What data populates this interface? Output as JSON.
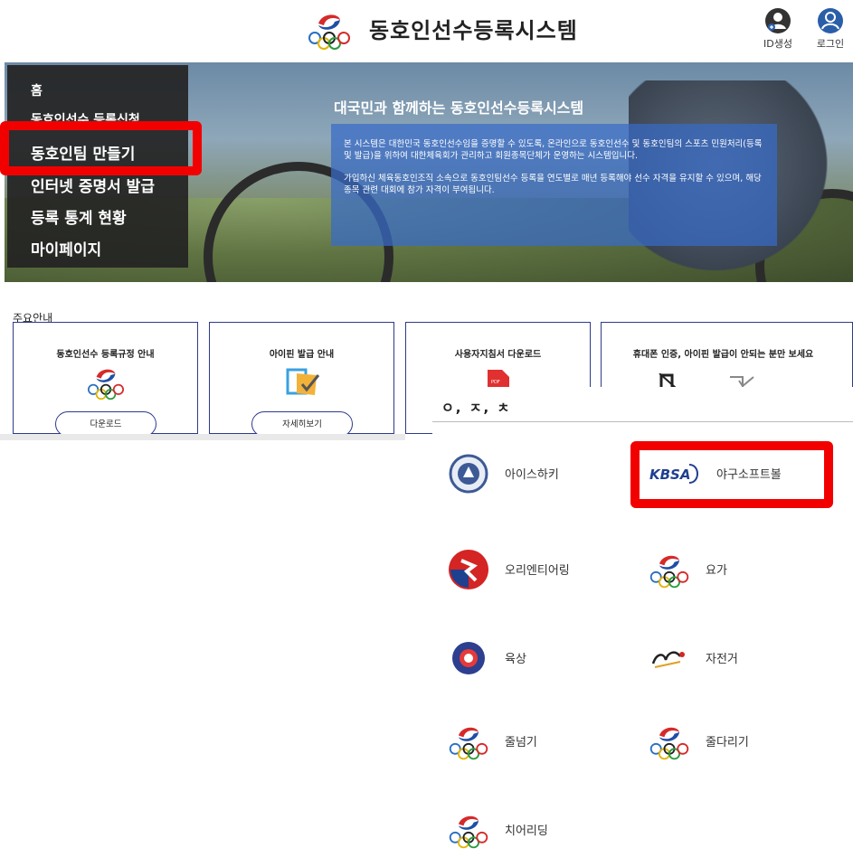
{
  "header": {
    "site_title": "동호인선수등록시스템",
    "id_create_label": "ID생성",
    "login_label": "로그인"
  },
  "nav": {
    "items": [
      {
        "label": "홈"
      },
      {
        "label": "동호인선수 등록신청"
      },
      {
        "label": "동호인팀 만들기"
      },
      {
        "label": "인터넷 증명서 발급"
      },
      {
        "label": "등록 통계 현황"
      },
      {
        "label": "마이페이지"
      }
    ]
  },
  "hero": {
    "title": "대국민과 함께하는 동호인선수등록시스템",
    "paragraph1": "본 시스템은 대한민국 동호인선수임을 증명할 수 있도록, 온라인으로 동호인선수 및 동호인팀의 스포츠 민원처리(등록 및 발급)을 위하여 대한체육회가 관리하고 회원종목단체가 운영하는 시스템입니다.",
    "paragraph2": "가입하신 체육동호인조직 소속으로 동호인팀선수 등록을 연도별로 매년 등록해야 선수 자격을 유지할 수 있으며, 해당 종목 관련 대회에 참가 자격이 부여됩니다."
  },
  "notices": {
    "section_label": "주요안내",
    "cards": [
      {
        "title": "동호인선수 등록규정 안내",
        "button": "다운로드",
        "icon": "olympic-logo-icon"
      },
      {
        "title": "아이핀 발급 안내",
        "button": "자세히보기",
        "icon": "ipin-icon"
      },
      {
        "title": "사용자지침서 다운로드",
        "icon": "pdf-icon"
      },
      {
        "title": "휴대폰 인증, 아이핀 발급이 안되는 분만 보세요",
        "icon": "phone-icon"
      }
    ]
  },
  "sports_panel": {
    "heading": "ㅇ, ㅈ, ㅊ",
    "items": [
      {
        "label": "아이스하키",
        "icon": "ice-hockey-emblem-icon"
      },
      {
        "label": "야구소프트볼",
        "icon": "kbsa-logo-icon",
        "logo_text": "KBSA"
      },
      {
        "label": "오리엔티어링",
        "icon": "orienteering-emblem-icon"
      },
      {
        "label": "요가",
        "icon": "olympic-logo-icon"
      },
      {
        "label": "육상",
        "icon": "athletics-emblem-icon"
      },
      {
        "label": "자전거",
        "icon": "cycling-logo-icon"
      },
      {
        "label": "줄넘기",
        "icon": "olympic-logo-icon"
      },
      {
        "label": "줄다리기",
        "icon": "olympic-logo-icon"
      },
      {
        "label": "치어리딩",
        "icon": "olympic-logo-icon"
      }
    ]
  },
  "colors": {
    "highlight": "#f20000",
    "card_border": "#2e3a8c",
    "hero_box": "#386bc8",
    "header_icon": "#2b5ea8"
  }
}
